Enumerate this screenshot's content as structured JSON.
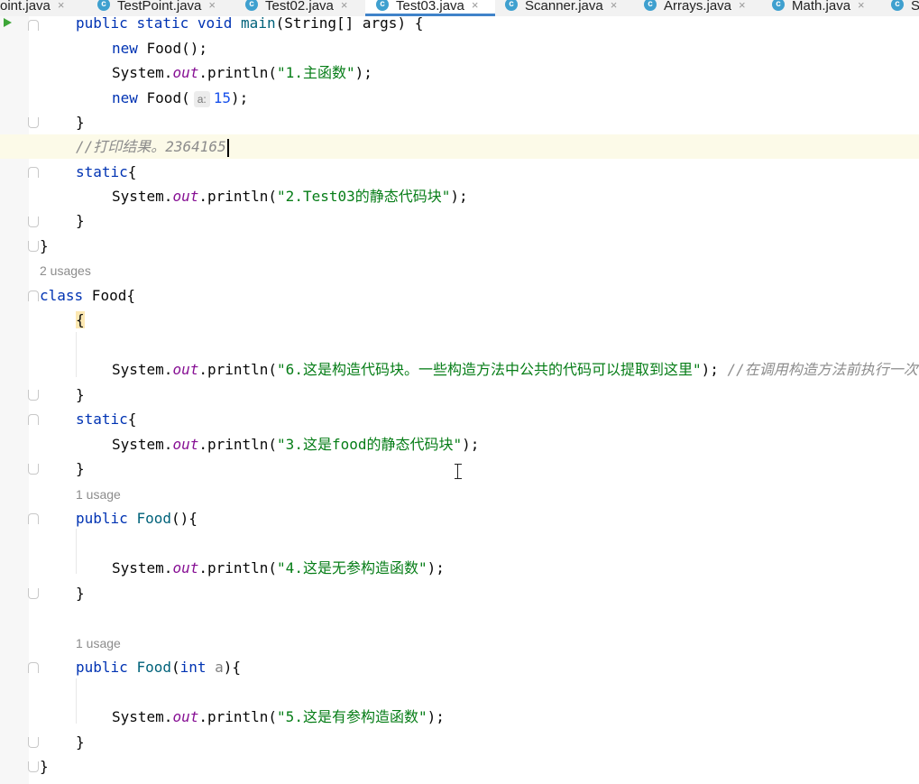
{
  "tabs": [
    {
      "label": "Point.java",
      "icon": "class-c-icon",
      "active": false
    },
    {
      "label": "TestPoint.java",
      "icon": "class-c-icon",
      "active": false
    },
    {
      "label": "Test02.java",
      "icon": "class-c-icon",
      "active": false
    },
    {
      "label": "Test03.java",
      "icon": "class-c-icon",
      "active": true
    },
    {
      "label": "Scanner.java",
      "icon": "class-c-icon",
      "active": false
    },
    {
      "label": "Arrays.java",
      "icon": "class-c-icon",
      "active": false
    },
    {
      "label": "Math.java",
      "icon": "class-c-icon",
      "active": false
    },
    {
      "label": "S",
      "icon": "class-c-icon",
      "active": false
    }
  ],
  "tab_icon_letter": "c",
  "close_glyph": "×",
  "code": {
    "main_sig": [
      "public",
      " ",
      "static",
      " ",
      "void",
      " ",
      "main",
      "(String[] args) {"
    ],
    "new_food_1": [
      "new",
      " Food();"
    ],
    "println_1": [
      "System.",
      "out",
      ".println(",
      "\"1.主函数\"",
      ");"
    ],
    "new_food_2": [
      "new",
      " Food(",
      "a:",
      "15",
      ");"
    ],
    "close_brace": "}",
    "comment_result": "//打印结果。2364165",
    "static_kw": "static",
    "open_brace": "{",
    "println_2": [
      "System.",
      "out",
      ".println(",
      "\"2.Test03的静态代码块\"",
      ");"
    ],
    "class_decl": [
      "class",
      " Food{"
    ],
    "println_6": [
      "System.",
      "out",
      ".println(",
      "\"6.这是构造代码块。一些构造方法中公共的代码可以提取到这里\"",
      "); ",
      "//在调用构造方法前执行一次"
    ],
    "println_3": [
      "System.",
      "out",
      ".println(",
      "\"3.这是food的静态代码块\"",
      ");"
    ],
    "ctor_noarg": [
      "public",
      " ",
      "Food",
      "(){"
    ],
    "println_4": [
      "System.",
      "out",
      ".println(",
      "\"4.这是无参构造函数\"",
      ");"
    ],
    "ctor_arg": [
      "public",
      " ",
      "Food",
      "(",
      "int",
      " ",
      "a",
      "){"
    ],
    "println_5": [
      "System.",
      "out",
      ".println(",
      "\"5.这是有参构造函数\"",
      ");"
    ]
  },
  "hints": {
    "usages_2": "2 usages",
    "usage_1a": "1 usage",
    "usage_1b": "1 usage"
  },
  "colors": {
    "keyword": "#0033b3",
    "string": "#067d17",
    "number": "#1750eb",
    "static_field": "#871094",
    "comment": "#8c8c8c",
    "active_tab_underline": "#4083c9",
    "current_line": "#fcfae8"
  }
}
